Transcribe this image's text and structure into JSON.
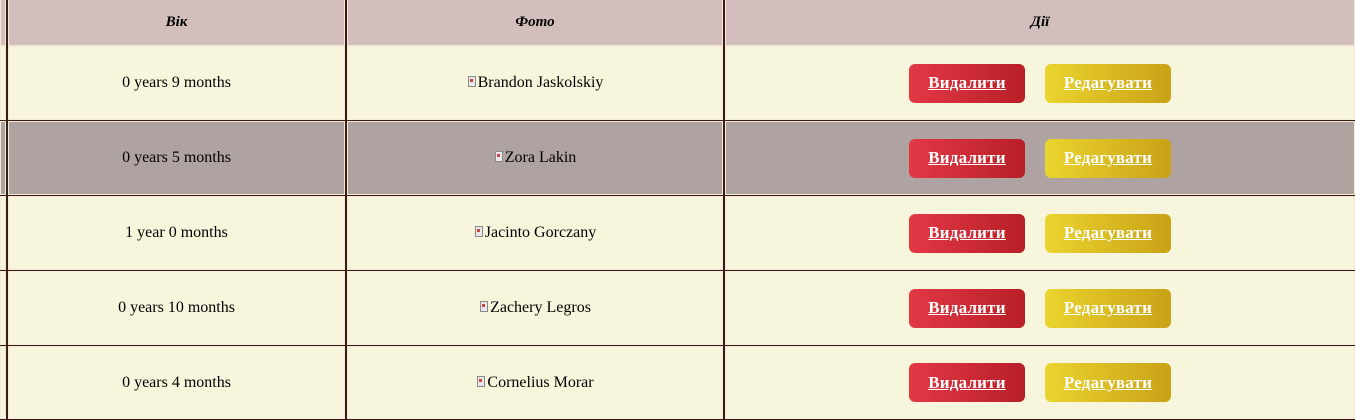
{
  "header": {
    "age": "Вік",
    "photo": "Фото",
    "actions": "Дії"
  },
  "rows": [
    {
      "age": "0 years 9 months",
      "photo_alt": "Brandon Jaskolskiy",
      "delete_label": "Видалити",
      "edit_label": "Редагувати"
    },
    {
      "age": "0 years 5 months",
      "photo_alt": "Zora Lakin",
      "delete_label": "Видалити",
      "edit_label": "Редагувати"
    },
    {
      "age": "1 year 0 months",
      "photo_alt": "Jacinto Gorczany",
      "delete_label": "Видалити",
      "edit_label": "Редагувати"
    },
    {
      "age": "0 years 10 months",
      "photo_alt": "Zachery Legros",
      "delete_label": "Видалити",
      "edit_label": "Редагувати"
    },
    {
      "age": "0 years 4 months",
      "photo_alt": "Cornelius Morar",
      "delete_label": "Видалити",
      "edit_label": "Редагувати"
    }
  ],
  "colors": {
    "header_bg": "#d3bebe",
    "row_light_bg": "#f7f6dc",
    "row_highlight_bg": "#afa3a1",
    "border": "#3b1c15",
    "delete_button": "#d12b35",
    "edit_button": "#dcbb22"
  }
}
